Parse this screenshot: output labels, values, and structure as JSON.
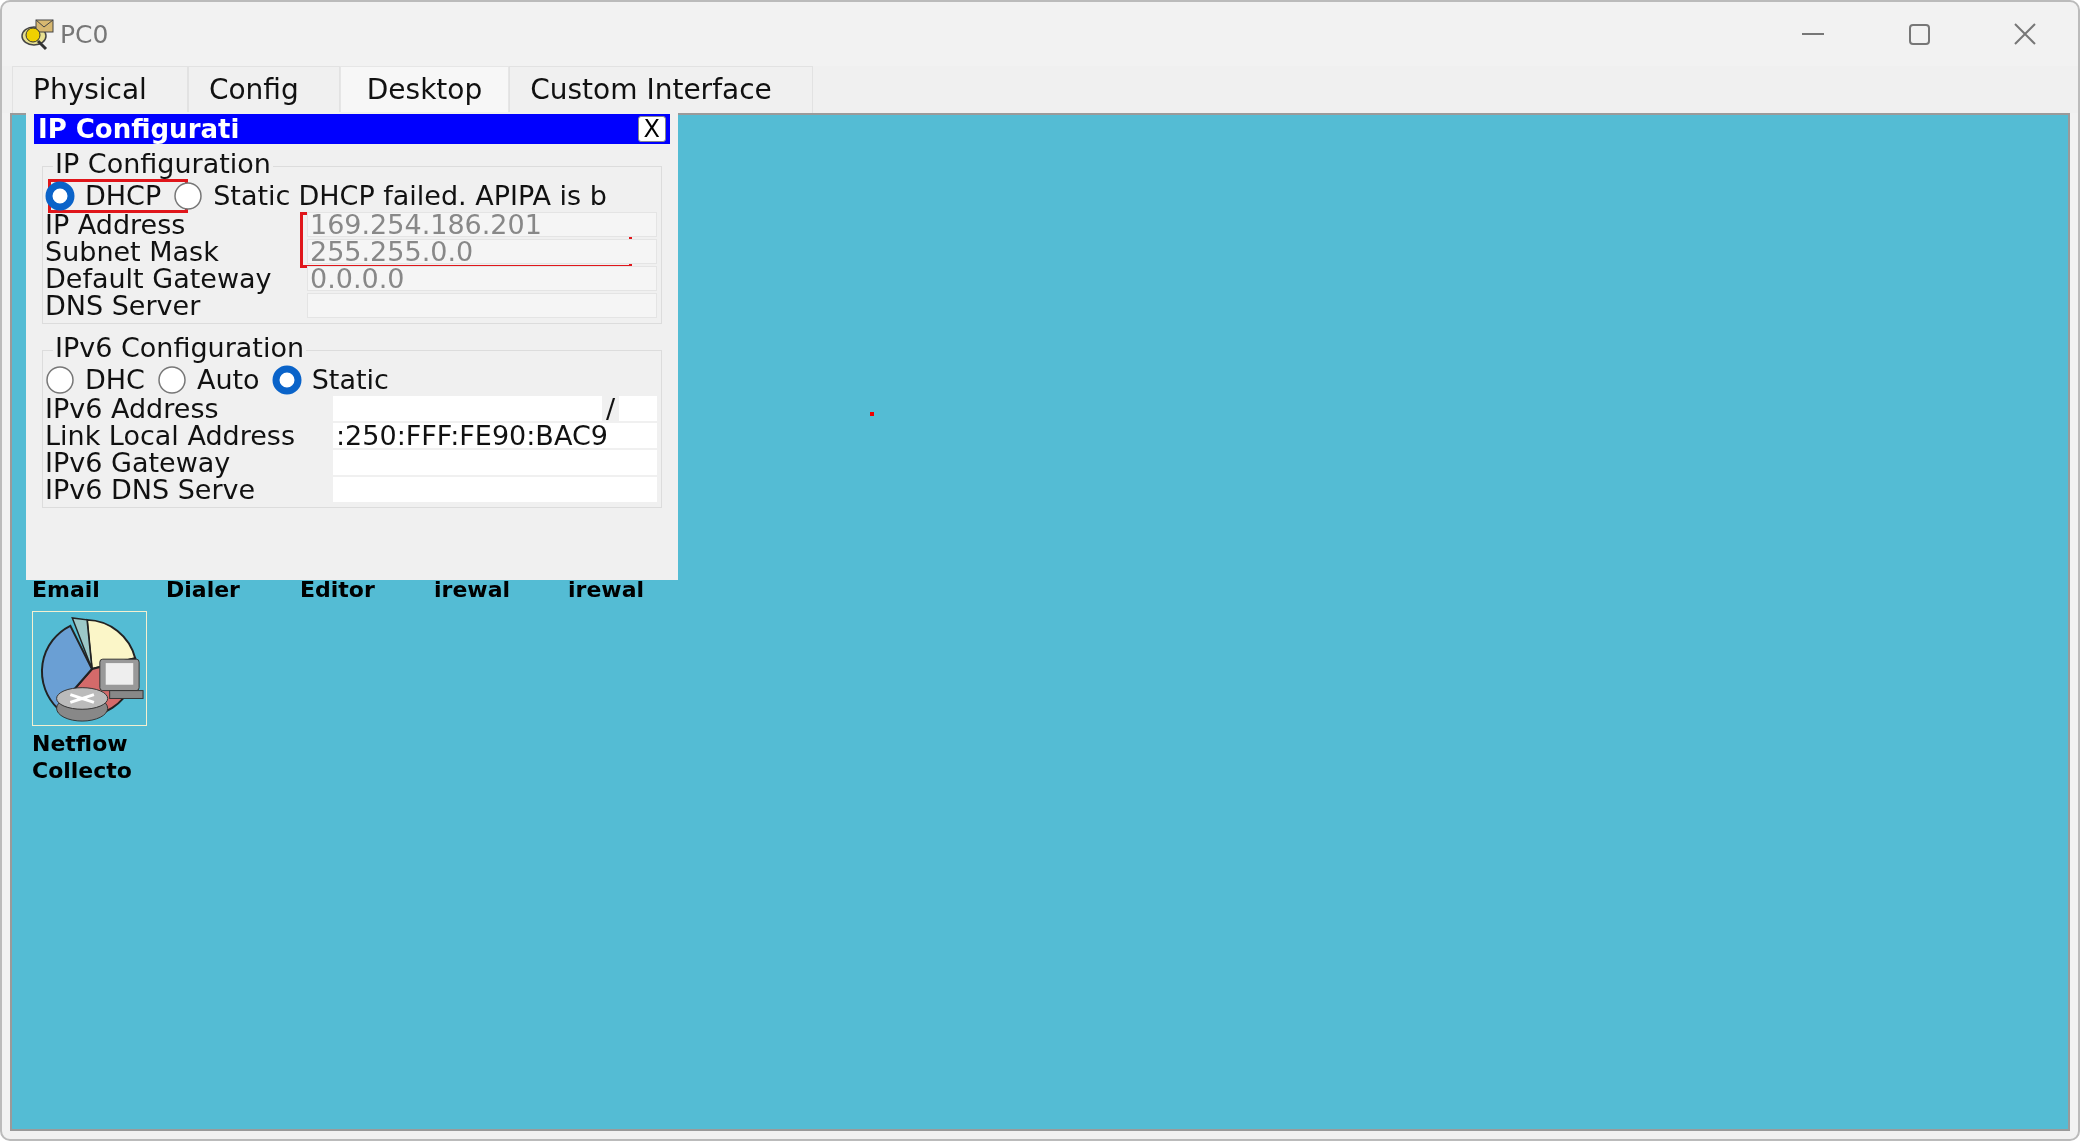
{
  "window": {
    "title": "PC0"
  },
  "tabs": [
    {
      "label": "Physical",
      "selected": false
    },
    {
      "label": "Config",
      "selected": false
    },
    {
      "label": "Desktop",
      "selected": true
    },
    {
      "label": "Custom Interface",
      "selected": false
    }
  ],
  "dialog": {
    "title": "IP Configurati",
    "close": "X",
    "ipv4": {
      "legend": "IP Configuration",
      "status": "DHCP failed. APIPA is b",
      "modes": [
        {
          "label": "DHCP",
          "selected": true
        },
        {
          "label": "Static",
          "selected": false
        }
      ],
      "fields": [
        {
          "label": "IP Address",
          "value": "169.254.186.201",
          "disabled": true
        },
        {
          "label": "Subnet Mask",
          "value": "255.255.0.0",
          "disabled": true
        },
        {
          "label": "Default Gateway",
          "value": "0.0.0.0",
          "disabled": true
        },
        {
          "label": "DNS Server",
          "disabled": true
        }
      ]
    },
    "ipv6": {
      "legend": "IPv6 Configuration",
      "modes": [
        {
          "label": "DHC",
          "selected": false
        },
        {
          "label": "Auto",
          "selected": false
        },
        {
          "label": "Static",
          "selected": true
        }
      ],
      "fields": [
        {
          "label": "IPv6 Address",
          "separator": "/",
          "disabled": false
        },
        {
          "label": "Link Local Address",
          "value": ":250:FFF:FE90:BAC9",
          "disabled": false
        },
        {
          "label": "IPv6 Gateway",
          "disabled": false
        },
        {
          "label": "IPv6 DNS Serve",
          "disabled": false
        }
      ]
    }
  },
  "desktop": {
    "hidden_icon_labels": [
      "Email",
      "Dialer",
      "Editor",
      "irewal",
      "irewal"
    ],
    "apps": [
      {
        "label": "Netflow Collecto"
      }
    ]
  }
}
